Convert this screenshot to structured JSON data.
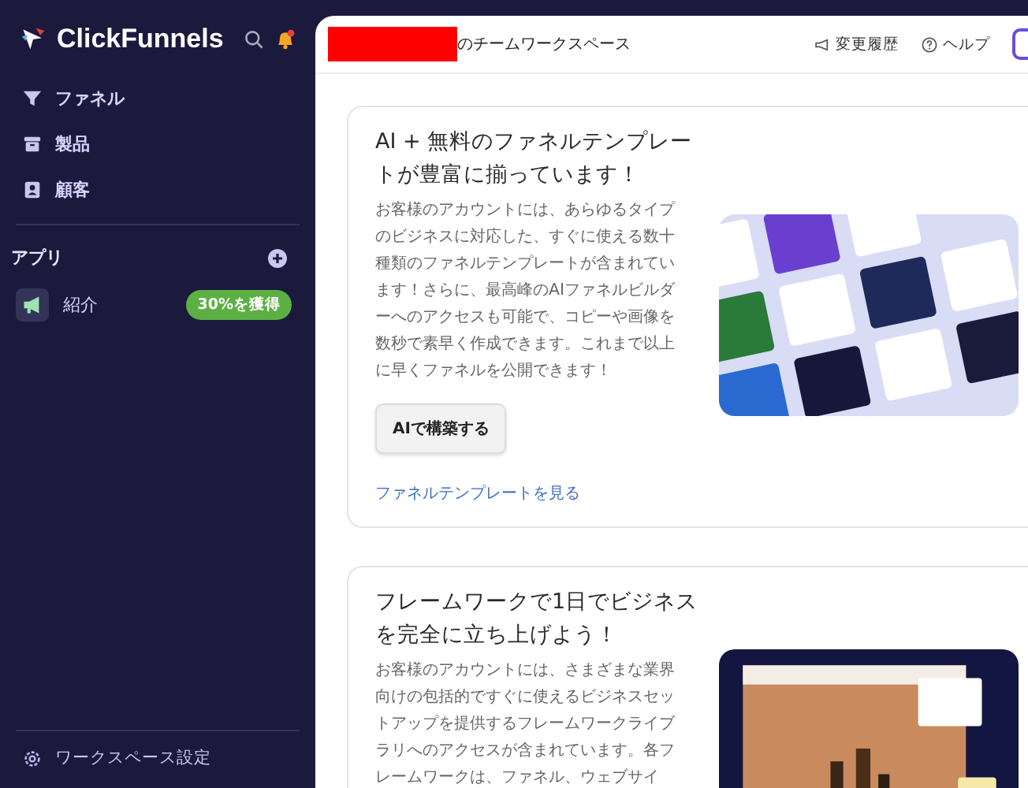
{
  "sidebar": {
    "brand": "ClickFunnels",
    "nav": [
      {
        "label": "ファネル"
      },
      {
        "label": "製品"
      },
      {
        "label": "顧客"
      }
    ],
    "apps_label": "アプリ",
    "apps": [
      {
        "label": "紹介",
        "badge": "30%を獲得"
      }
    ],
    "footer": "ワークスペース設定"
  },
  "header": {
    "title": "のチームワークスペース",
    "actions": [
      {
        "label": "変更履歴"
      },
      {
        "label": "ヘルプ"
      }
    ]
  },
  "cards": [
    {
      "title": "AI + 無料のファネルテンプレートが豊富に揃っています！",
      "body": "お客様のアカウントには、あらゆるタイプのビジネスに対応した、すぐに使える数十種類のファネルテンプレートが含まれています！さらに、最高峰のAIファネルビルダーへのアクセスも可能で、コピーや画像を数秒で素早く作成できます。これまで以上に早くファネルを公開できます！",
      "button": "AIで構築する",
      "link": "ファネルテンプレートを見る"
    },
    {
      "title": "フレームワークで1日でビジネスを完全に立ち上げよう！",
      "body": "お客様のアカウントには、さまざまな業界向けの包括的ですぐに使えるビジネスセットアップを提供するフレームワークライブラリへのアクセスが含まれています。各フレームワークは、ファネル、ウェブサイ"
    }
  ]
}
